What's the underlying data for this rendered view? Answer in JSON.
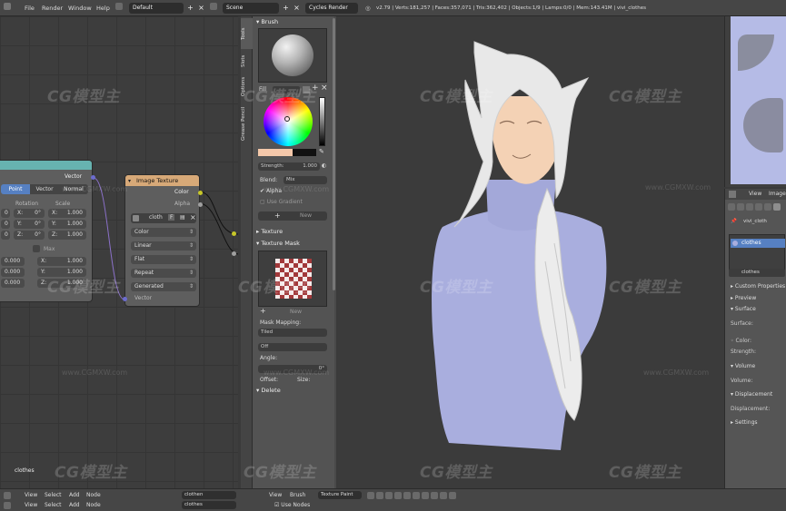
{
  "menu": {
    "file": "File",
    "render": "Render",
    "window": "Window",
    "help": "Help",
    "screen_layout": "Default",
    "scene": "Scene",
    "engine": "Cycles Render",
    "stats": "v2.79 | Verts:181,257 | Faces:357,071 | Tris:362,402 | Objects:1/9 | Lamps:0/0 | Mem:143.41M | vivi_clothes"
  },
  "node_editor": {
    "mapping_node": {
      "vector_out": "Vector",
      "tabs": [
        "Point",
        "Vector",
        "Normal"
      ],
      "rotation_label": "Rotation",
      "scale_label": "Scale",
      "loc_x": "0",
      "loc_y": "0",
      "loc_z": "0",
      "rot_x": "X:",
      "rot_x_val": "0°",
      "rot_y": "Y:",
      "rot_y_val": "0°",
      "rot_z": "Z:",
      "rot_z_val": "0°",
      "scale_x": "1.000",
      "scale_y": "1.000",
      "scale_z": "1.000",
      "scale_x_label": "X:",
      "scale_y_label": "Y:",
      "scale_z_label": "Z:",
      "max_label": "Max",
      "min_vals": [
        "0.000",
        "0.000",
        "0.000"
      ],
      "max_x_label": "X:",
      "max_y_label": "Y:",
      "max_z_label": "Z:",
      "max_vals": [
        "1.000",
        "1.000",
        "1.000"
      ]
    },
    "image_texture_node": {
      "title": "Image Texture",
      "color_out": "Color",
      "alpha_out": "Alpha",
      "image_name": "cloth",
      "fake_user": "F",
      "color_space": "Color",
      "interpolation": "Linear",
      "projection": "Flat",
      "extension": "Repeat",
      "source": "Generated",
      "vector_in": "Vector"
    },
    "footer_label": "clothes"
  },
  "tool_tabs": [
    "Tools",
    "Slots",
    "Options",
    "Grease Pencil"
  ],
  "tool_panel": {
    "brush_header": "Brush",
    "fill_label": "Fill",
    "strength_label": "Strength:",
    "strength_value": "1.000",
    "blend_label": "Blend:",
    "blend_value": "Mix",
    "alpha_label": "Alpha",
    "use_gradient_label": "Use Gradient",
    "new_label": "New",
    "texture_header": "Texture",
    "texture_mask_header": "Texture Mask",
    "mask_new_label": "New",
    "mask_mapping_label": "Mask Mapping:",
    "mask_mapping_value": "Tiled",
    "off_value": "Off",
    "angle_label": "Angle:",
    "angle_value": "0°",
    "offset_label": "Offset:",
    "size_label": "Size:",
    "delete_header": "Delete"
  },
  "properties": {
    "view_tab": "View",
    "image_tab": "Image",
    "object_name": "vivi_cloth",
    "material_slot": "clothes",
    "material_name": "clothes",
    "custom_props": "Custom Properties",
    "preview": "Preview",
    "surface": "Surface",
    "surface_label": "Surface:",
    "color_label": "Color:",
    "strength_label": "Strength:",
    "volume": "Volume",
    "volume_label": "Volume:",
    "displacement": "Displacement",
    "displacement_label": "Displacement:",
    "settings": "Settings"
  },
  "bottom_bar": {
    "row1": {
      "view": "View",
      "select": "Select",
      "add": "Add",
      "node": "Node",
      "material_name": "clothen"
    },
    "row2": {
      "view": "View",
      "select": "Select",
      "add": "Add",
      "node": "Node",
      "material_name": "clothes",
      "use_nodes": "Use Nodes"
    },
    "viewport_view": "View",
    "viewport_brush": "Brush",
    "mode": "Texture Paint"
  },
  "watermarks": [
    "CG模型主",
    "CG模型主",
    "CG模型主",
    "CG模型主",
    "CG模型主",
    "CG模型主",
    "CG模型主",
    "CG模型主",
    "CG模型主",
    "CG模型主",
    "CG模型主",
    "CG模型主"
  ],
  "watermark_urls": [
    "www.CGMXW.com",
    "www.CGMXW.com",
    "www.CGMXW.com",
    "www.CGMXW.com",
    "www.CGMXW.com",
    "www.CGMXW.com"
  ],
  "colors": {
    "mapping_header": "#67b3b0",
    "texture_header": "#d7a978",
    "sweater": "#a9aede",
    "skin": "#f4d2b5",
    "hair": "#e8e8e8"
  }
}
